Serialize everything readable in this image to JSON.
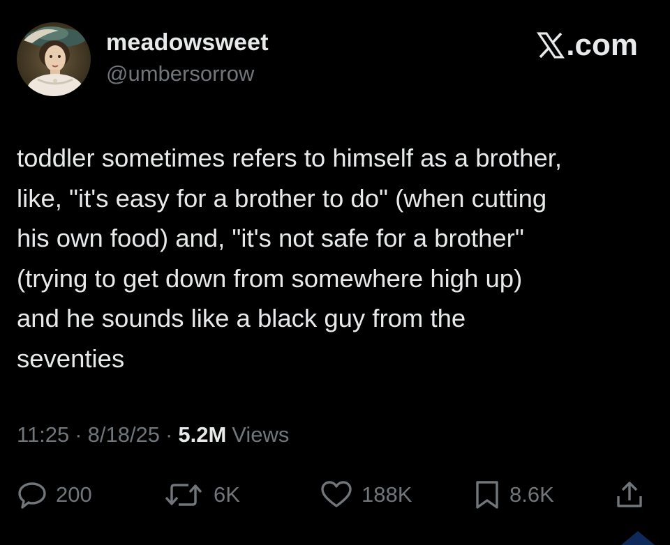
{
  "user": {
    "display_name": "meadowsweet",
    "handle": "@umbersorrow",
    "avatar_icon": "portrait-avatar-icon"
  },
  "brand": {
    "label": ".com",
    "logo_icon": "x-logo-icon"
  },
  "tweet": {
    "text": "toddler sometimes refers to himself as a brother,\nlike, \"it's easy for a brother to do\" (when cutting\nhis own food) and, \"it's not safe for a brother\"\n(trying to get down from somewhere high up)\nand he sounds like a black guy from the\nseventies"
  },
  "meta": {
    "time": "11:25",
    "date": "8/18/25",
    "views_count": "5.2M",
    "views_label": "Views",
    "separator": "·"
  },
  "actions": {
    "replies": "200",
    "reposts": "6K",
    "likes": "188K",
    "bookmarks": "8.6K"
  },
  "colors": {
    "background": "#000000",
    "text_primary": "#e7e9ea",
    "text_secondary": "#71767b"
  }
}
